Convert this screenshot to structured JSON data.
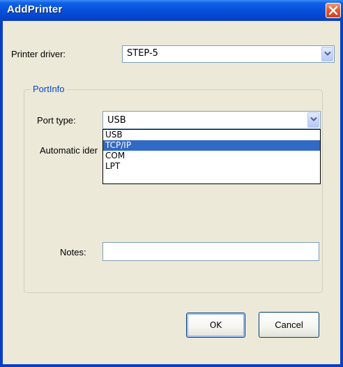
{
  "window": {
    "title": "AddPrinter",
    "close_icon": "close-icon",
    "colors": {
      "titlebar": "#0652dc",
      "close_button": "#e05b36",
      "dialog_background": "#ece9d8",
      "selection": "#316ac5",
      "group_title": "#0046d5"
    }
  },
  "printer_driver": {
    "label": "Printer driver:",
    "value": "STEP-5",
    "icon": "chevron-down-icon"
  },
  "port_info": {
    "title": "PortInfo",
    "port_type": {
      "label": "Port type:",
      "value": "USB",
      "icon": "chevron-down-icon",
      "options": [
        "USB",
        "TCP/IP",
        "COM",
        "LPT"
      ],
      "highlighted_option": "TCP/IP"
    },
    "automatic_label": "Automatic ider",
    "notes": {
      "label": "Notes:",
      "value": ""
    }
  },
  "buttons": {
    "ok": "OK",
    "cancel": "Cancel"
  }
}
